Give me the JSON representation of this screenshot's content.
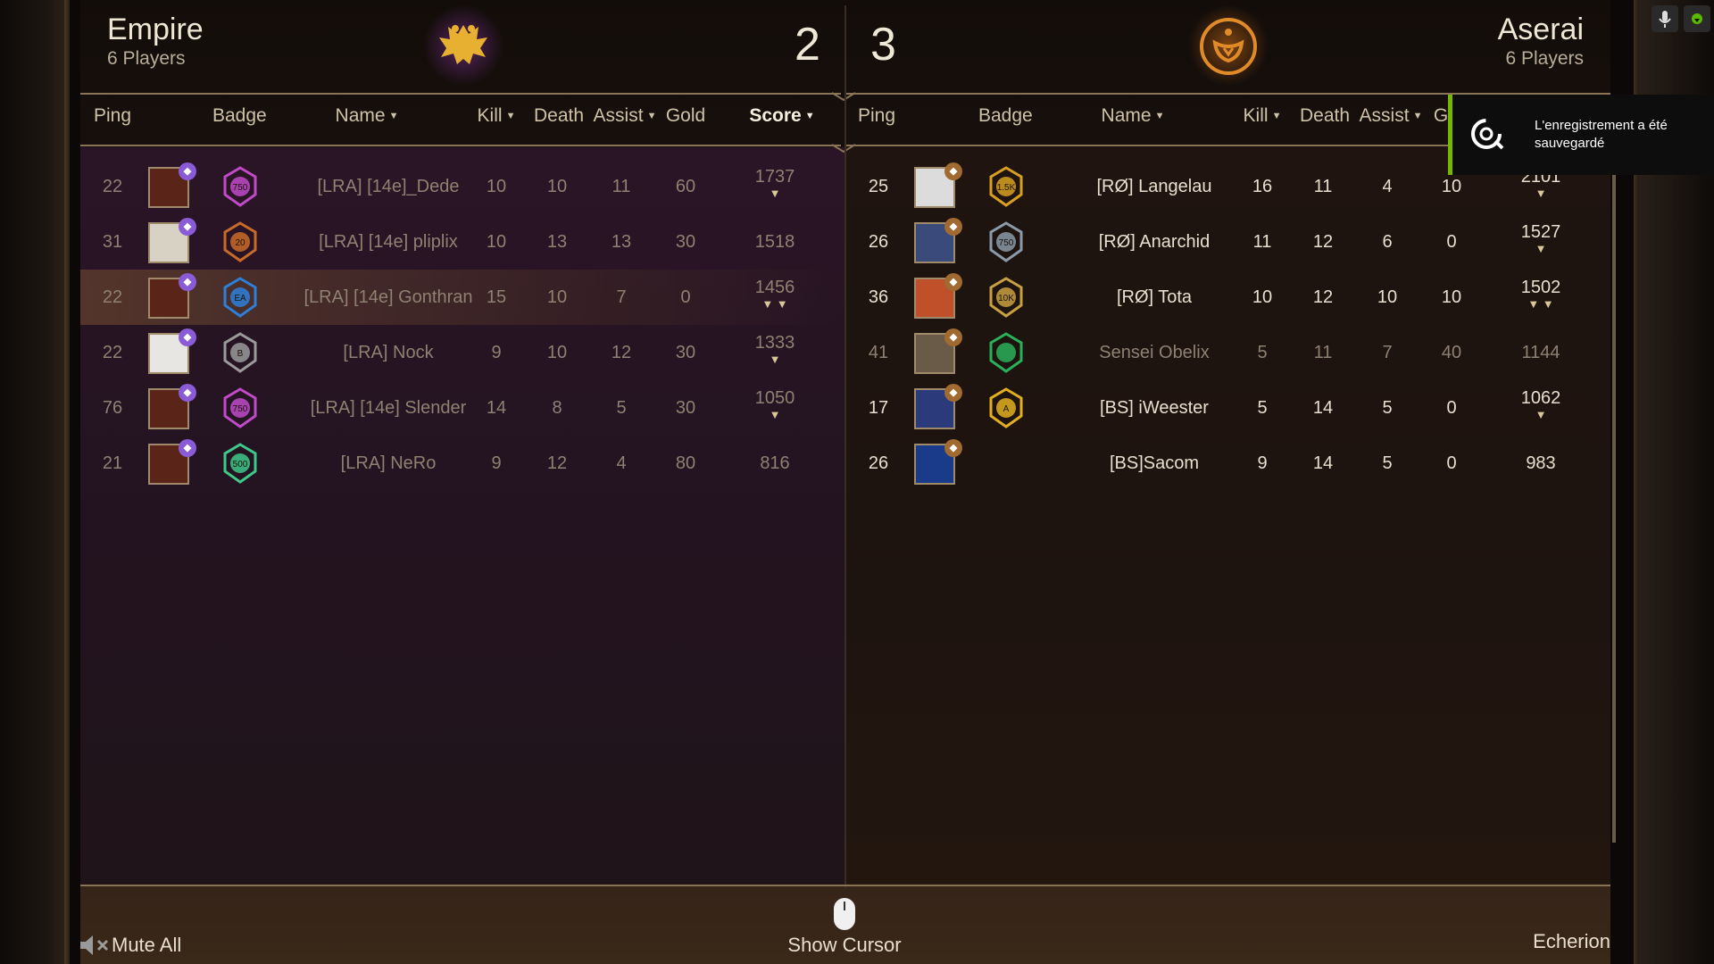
{
  "left_team": {
    "name": "Empire",
    "subtitle": "6 Players",
    "round_score": "2",
    "emblem": "double-headed-eagle-icon",
    "headers": [
      {
        "label": "Ping",
        "sort": false
      },
      {
        "label": "Badge",
        "sort": false
      },
      {
        "label": "Name",
        "sort": true
      },
      {
        "label": "Kill",
        "sort": true
      },
      {
        "label": "Death",
        "sort": false
      },
      {
        "label": "Assist",
        "sort": true
      },
      {
        "label": "Gold",
        "sort": false
      },
      {
        "label": "Score",
        "sort": true,
        "active": true
      }
    ],
    "players": [
      {
        "ping": "22",
        "name": "[LRA] [14e]_Dede",
        "kill": "10",
        "death": "10",
        "assist": "11",
        "gold": "60",
        "score": "1737",
        "shields": "▼",
        "badge": "750",
        "avatar_color": "#5a2418",
        "lvl_color": "#8a5bd6",
        "badge_color": "#c04ac8",
        "dim": true,
        "highlight": false
      },
      {
        "ping": "31",
        "name": "[LRA] [14e] pliplix",
        "kill": "10",
        "death": "13",
        "assist": "13",
        "gold": "30",
        "score": "1518",
        "shields": "",
        "badge": "20",
        "avatar_color": "#d8d2c4",
        "lvl_color": "#8a5bd6",
        "badge_color": "#c86a28",
        "dim": true,
        "highlight": false
      },
      {
        "ping": "22",
        "name": "[LRA] [14e] Gonthran",
        "kill": "15",
        "death": "10",
        "assist": "7",
        "gold": "0",
        "score": "1456",
        "shields": "▼ ▼",
        "badge": "EA",
        "avatar_color": "#5a2418",
        "lvl_color": "#8a5bd6",
        "badge_color": "#2d7fd8",
        "dim": true,
        "highlight": true
      },
      {
        "ping": "22",
        "name": "[LRA] Nock",
        "kill": "9",
        "death": "10",
        "assist": "12",
        "gold": "30",
        "score": "1333",
        "shields": "▼",
        "badge": "B",
        "avatar_color": "#e8e6e2",
        "lvl_color": "#8a5bd6",
        "badge_color": "#9a9a9a",
        "dim": true,
        "highlight": false
      },
      {
        "ping": "76",
        "name": "[LRA] [14e] Slender",
        "kill": "14",
        "death": "8",
        "assist": "5",
        "gold": "30",
        "score": "1050",
        "shields": "▼",
        "badge": "750",
        "avatar_color": "#5a2418",
        "lvl_color": "#8a5bd6",
        "badge_color": "#c04ac8",
        "dim": true,
        "highlight": false
      },
      {
        "ping": "21",
        "name": "[LRA] NeRo",
        "kill": "9",
        "death": "12",
        "assist": "4",
        "gold": "80",
        "score": "816",
        "shields": "",
        "badge": "500",
        "avatar_color": "#5a2418",
        "lvl_color": "#8a5bd6",
        "badge_color": "#3ec88a",
        "dim": true,
        "highlight": false
      }
    ]
  },
  "right_team": {
    "name": "Aserai",
    "subtitle": "6 Players",
    "round_score": "3",
    "emblem": "aserai-crest-icon",
    "headers": [
      {
        "label": "Ping",
        "sort": false
      },
      {
        "label": "Badge",
        "sort": false
      },
      {
        "label": "Name",
        "sort": true
      },
      {
        "label": "Kill",
        "sort": true
      },
      {
        "label": "Death",
        "sort": false
      },
      {
        "label": "Assist",
        "sort": true
      },
      {
        "label": "G",
        "sort": false
      }
    ],
    "players": [
      {
        "ping": "25",
        "name": "[RØ] Langelau",
        "kill": "16",
        "death": "11",
        "assist": "4",
        "gold": "10",
        "score": "2101",
        "shields": "▼",
        "badge": "1.5K",
        "avatar_color": "#dcdcdc",
        "lvl_color": "#a06a30",
        "badge_color": "#d8a020",
        "dim": false
      },
      {
        "ping": "26",
        "name": "[RØ] Anarchid",
        "kill": "11",
        "death": "12",
        "assist": "6",
        "gold": "0",
        "score": "1527",
        "shields": "▼",
        "badge": "750",
        "avatar_color": "#3a4a7a",
        "lvl_color": "#a06a30",
        "badge_color": "#8a9aa8",
        "dim": false
      },
      {
        "ping": "36",
        "name": "[RØ] Tota",
        "kill": "10",
        "death": "12",
        "assist": "10",
        "gold": "10",
        "score": "1502",
        "shields": "▼ ▼",
        "badge": "10K",
        "avatar_color": "#c0502a",
        "lvl_color": "#a06a30",
        "badge_color": "#c8a040",
        "dim": false
      },
      {
        "ping": "41",
        "name": "Sensei Obelix",
        "kill": "5",
        "death": "11",
        "assist": "7",
        "gold": "40",
        "score": "1144",
        "shields": "",
        "badge": "",
        "avatar_color": "#6a5a48",
        "lvl_color": "#a06a30",
        "badge_color": "#2ab05a",
        "dim": true
      },
      {
        "ping": "17",
        "name": "[BS] iWeester",
        "kill": "5",
        "death": "14",
        "assist": "5",
        "gold": "0",
        "score": "1062",
        "shields": "▼",
        "badge": "A",
        "avatar_color": "#2a3a7a",
        "lvl_color": "#a06a30",
        "badge_color": "#e0b020",
        "dim": false
      },
      {
        "ping": "26",
        "name": "[BS]Sacom",
        "kill": "9",
        "death": "14",
        "assist": "5",
        "gold": "0",
        "score": "983",
        "shields": "",
        "badge": "",
        "avatar_color": "#1a3a8a",
        "lvl_color": "#a06a30",
        "badge_color": "",
        "dim": false
      }
    ]
  },
  "notification": {
    "text": "L'enregistrement a été sauvegardé",
    "icon": "recording-saved-icon"
  },
  "footer": {
    "mute_label": "Mute All",
    "show_cursor_label": "Show Cursor",
    "username": "Echerion"
  }
}
